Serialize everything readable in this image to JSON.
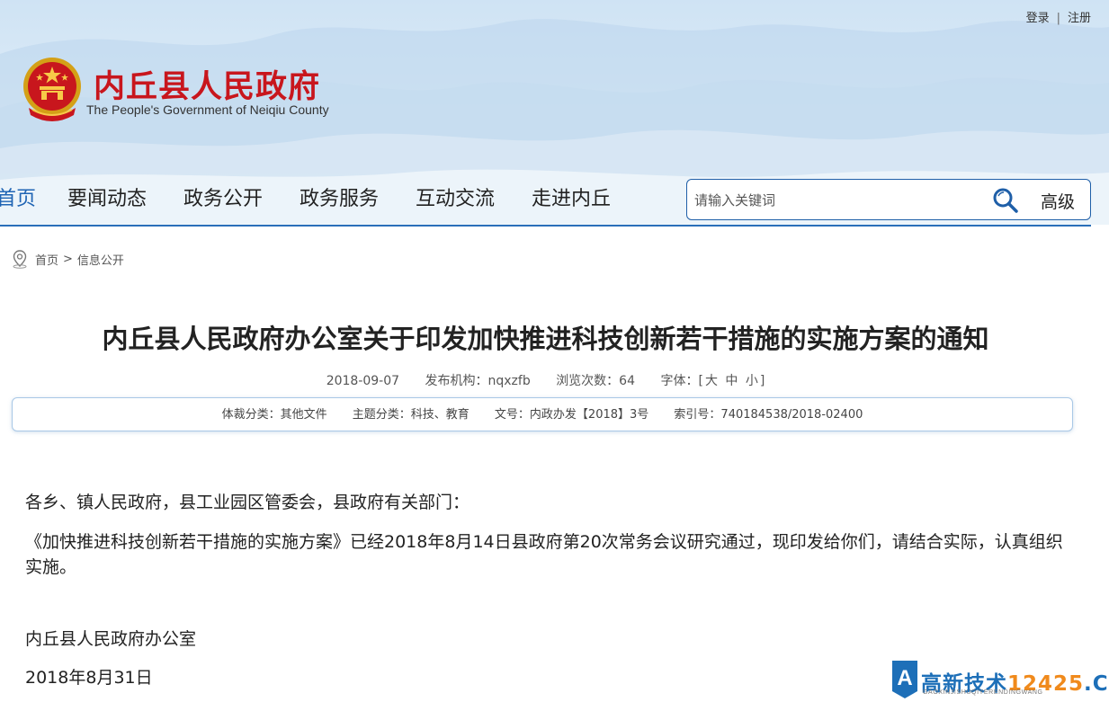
{
  "header": {
    "title": "内丘县人民政府",
    "subtitle": "The People's Government of Neiqiu County",
    "login": "登录",
    "separator": "|",
    "register": "注册"
  },
  "nav": {
    "items": [
      {
        "label": "首页",
        "active": true
      },
      {
        "label": "要闻动态"
      },
      {
        "label": "政务公开"
      },
      {
        "label": "政务服务"
      },
      {
        "label": "互动交流"
      },
      {
        "label": "走进内丘"
      }
    ]
  },
  "search": {
    "placeholder": "请输入关键词",
    "advanced_label": "高级"
  },
  "breadcrumb": {
    "home": "首页",
    "arrow": ">",
    "current": "信息公开"
  },
  "article": {
    "title": "内丘县人民政府办公室关于印发加快推进科技创新若干措施的实施方案的通知",
    "date": "2018-09-07",
    "publisher": "发布机构：nqxzfb",
    "views": "浏览次数：64",
    "font_label": "字体：",
    "font_open": "[",
    "font_large": "大",
    "font_medium": "中",
    "font_small": "小",
    "font_close": "]",
    "info": {
      "genre": "体裁分类：其他文件",
      "topic": "主题分类：科技、教育",
      "doc_no": "文号：内政办发【2018】3号",
      "index_no": "索引号：740184538/2018-02400"
    },
    "salutation": "各乡、镇人民政府，县工业园区管委会，县政府有关部门：",
    "body": "《加快推进科技创新若干措施的实施方案》已经2018年8月14日县政府第20次常务会议研究通过，现印发给你们，请结合实际，认真组织实施。",
    "signature": "内丘县人民政府办公室",
    "sign_date": "2018年8月31日"
  },
  "watermark": {
    "text_cn": "高新技术",
    "text_num": "12425",
    "text_cn_suffix": ".CN",
    "sub": "GAOXINJISHUQIYERENDINGWANG"
  },
  "colors": {
    "brand_red": "#c8161d",
    "nav_active": "#1f64b4",
    "search_border": "#1f5fa8",
    "info_border": "#a9c8e6"
  }
}
